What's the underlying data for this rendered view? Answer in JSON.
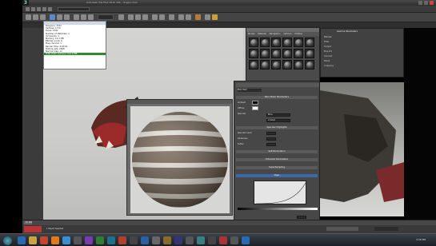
{
  "app": {
    "title": "Autodesk 3ds Max 2012 x64 - dragon.max",
    "menu": [
      "Edit",
      "Tools",
      "Group",
      "Views",
      "Create",
      "Modifiers",
      "Animation",
      "Graph Editors",
      "Rendering",
      "Customize",
      "MAXScript",
      "Help"
    ]
  },
  "stats_panel": {
    "rows": [
      "Polygons: 1532",
      "Vertices: 1770",
      "Faces: 1532",
      "Number of Materials: 1",
      "UV Islands: 1",
      "Memory: 12.3 MB",
      "Bitmap count: 6",
      "Map channel: 1",
      "Render time: 0:00:01",
      "Texture size: 2048",
      "Normal map: on",
      "Total video memory: 512.0 MB"
    ],
    "selected_row": 11
  },
  "material_editor": {
    "menu": [
      "Modes",
      "Material",
      "Navigation",
      "Options",
      "Utilities"
    ],
    "slot_count": 18
  },
  "params_panel": {
    "name": "Main Wall",
    "sections": [
      "Blinn Basic Parameters",
      "Specular Highlights",
      "Self-Illumination",
      "Extended Parameters",
      "SuperSampling",
      "Maps"
    ],
    "fields": [
      "Ambient",
      "Diffuse",
      "Specular",
      "Opacity",
      "Specular Level",
      "Glossiness",
      "Soften"
    ],
    "shader": "Blinn",
    "wire": "2-Sided"
  },
  "command_panel": {
    "title": "Gamma Parameters",
    "rows": [
      "Bitmap:",
      "Filter",
      "Output",
      "Map #1",
      "Amount",
      "Noise",
      "Cropping"
    ]
  },
  "timeline": {
    "range": "0 / 100",
    "status": "1 Object Selected"
  },
  "taskbar": {
    "clock": "3:38 PM"
  },
  "colors": {
    "accent": "#2f8a2f",
    "viewport_bg": "#cfcfcd",
    "panel": "#474747"
  }
}
